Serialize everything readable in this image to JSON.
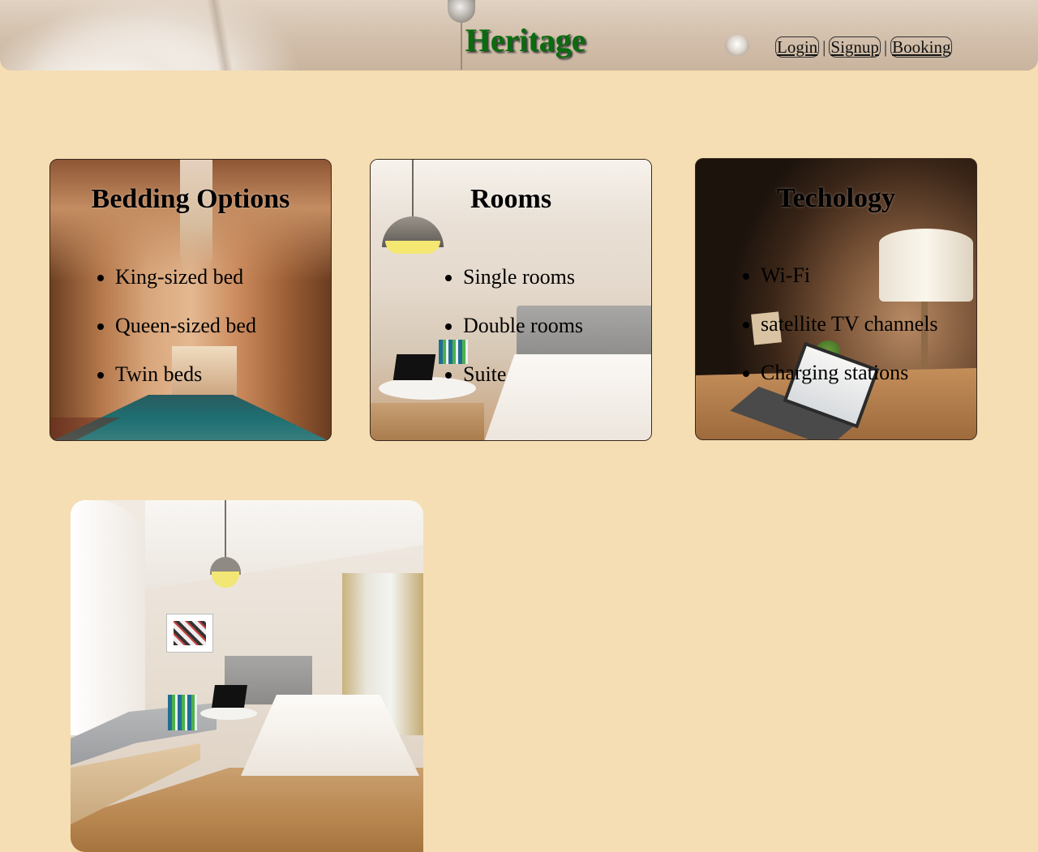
{
  "header": {
    "title": "Heritage",
    "nav": {
      "login": "Login",
      "separator_1": "|",
      "signup": "Signup",
      "separator_2": "|",
      "booking": "Booking"
    }
  },
  "cards": [
    {
      "heading": "Bedding Options",
      "items": [
        "King-sized bed",
        "Queen-sized bed",
        "Twin beds"
      ]
    },
    {
      "heading": "Rooms",
      "items": [
        "Single rooms",
        "Double rooms",
        "Suite"
      ]
    },
    {
      "heading": "Techology",
      "items": [
        "Wi-Fi",
        "satellite TV channels",
        "Charging stations"
      ]
    }
  ],
  "colors": {
    "background": "#f5deb3",
    "title_green": "#0b6b10"
  }
}
